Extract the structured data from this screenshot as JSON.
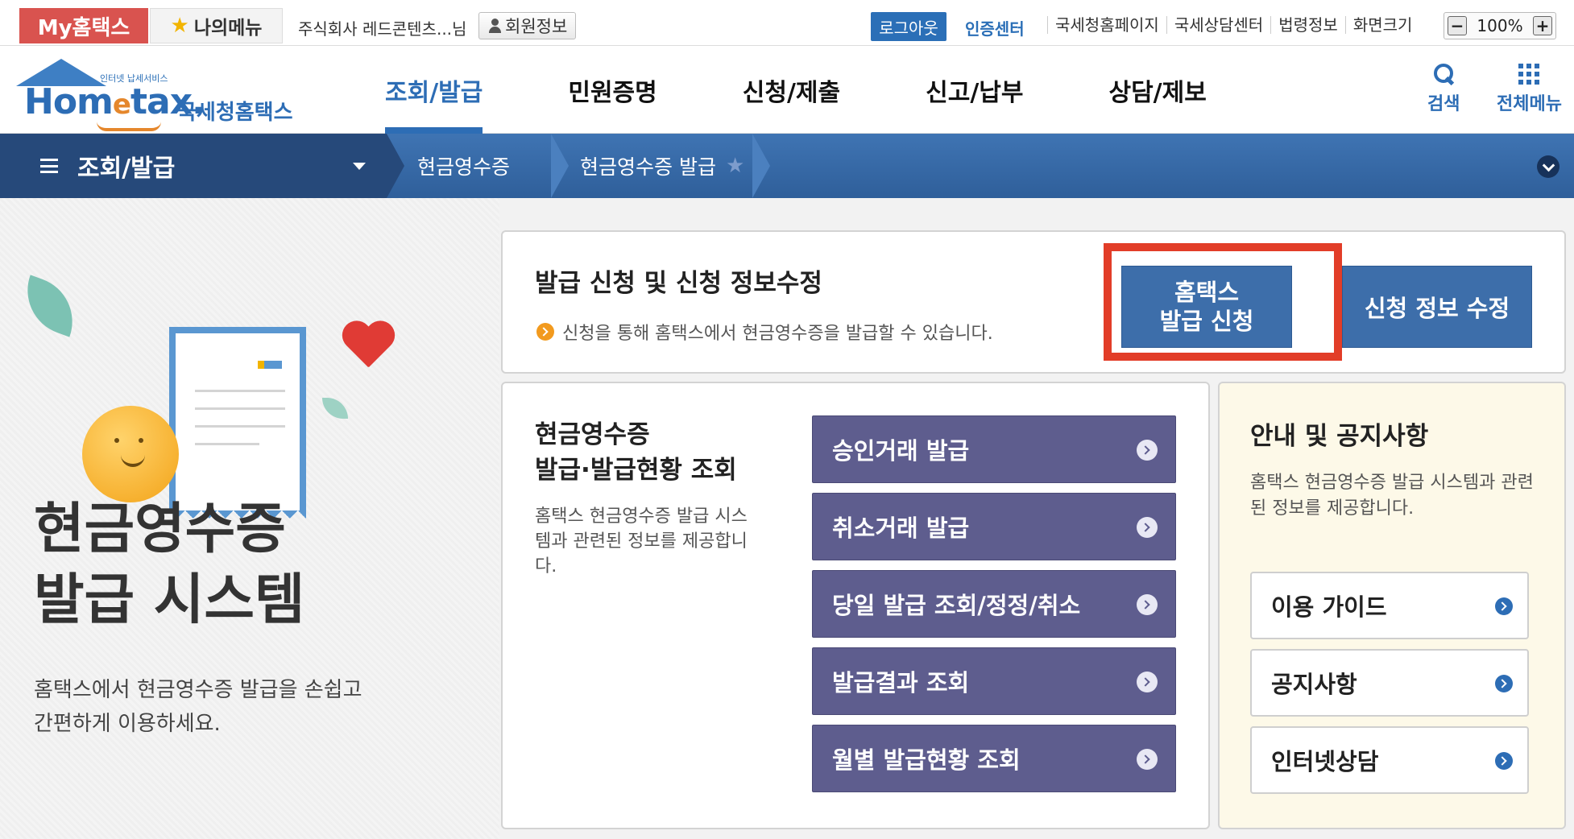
{
  "topbar": {
    "my_hometax": "My홈택스",
    "my_menu": "나의메뉴",
    "company_name": "주식회사 레드콘텐츠...님",
    "member_info": "회원정보",
    "logout": "로그아웃",
    "cert_center": "인증센터",
    "links": [
      "국세청홈페이지",
      "국세상담센터",
      "법령정보",
      "화면크기"
    ],
    "zoom_minus": "−",
    "zoom_level": "100%",
    "zoom_plus": "+"
  },
  "header": {
    "logo_sub": "인터넷 납세서비스",
    "logo_word_a": "Hom",
    "logo_word_e": "e",
    "logo_word_b": "tax.",
    "logo_kor": "국세청홈택스",
    "nav": [
      "조회/발급",
      "민원증명",
      "신청/제출",
      "신고/납부",
      "상담/제보"
    ],
    "search_label": "검색",
    "menu_label": "전체메뉴"
  },
  "breadcrumb": {
    "section": "조회/발급",
    "level1": "현금영수증",
    "level2": "현금영수증 발급"
  },
  "hero": {
    "title_line1": "현금영수증",
    "title_line2": "발급 시스템",
    "desc_line1": "홈택스에서 현금영수증 발급을 손쉽고",
    "desc_line2": "간편하게 이용하세요."
  },
  "apply_panel": {
    "title": "발급 신청 및 신청 정보수정",
    "info": "신청을 통해 홈택스에서 현금영수증을 발급할 수 있습니다.",
    "apply_btn_line1": "홈택스",
    "apply_btn_line2": "발급 신청",
    "modify_btn": "신청 정보 수정"
  },
  "issue_panel": {
    "title_line1": "현금영수증",
    "title_line2": "발급·발급현황 조회",
    "desc": "홈택스 현금영수증 발급 시스템과 관련된 정보를 제공합니다.",
    "buttons": [
      "승인거래 발급",
      "취소거래 발급",
      "당일 발급 조회/정정/취소",
      "발급결과 조회",
      "월별 발급현황 조회"
    ]
  },
  "notice_panel": {
    "title": "안내 및 공지사항",
    "desc": "홈택스 현금영수증 발급 시스템과 관련된 정보를 제공합니다.",
    "links": [
      "이용 가이드",
      "공지사항",
      "인터넷상담"
    ]
  },
  "colors": {
    "brand_blue": "#2d6db5",
    "highlight_red": "#e23d28",
    "action_purple": "#5e5d8e",
    "primary_button": "#3d6eaa"
  }
}
